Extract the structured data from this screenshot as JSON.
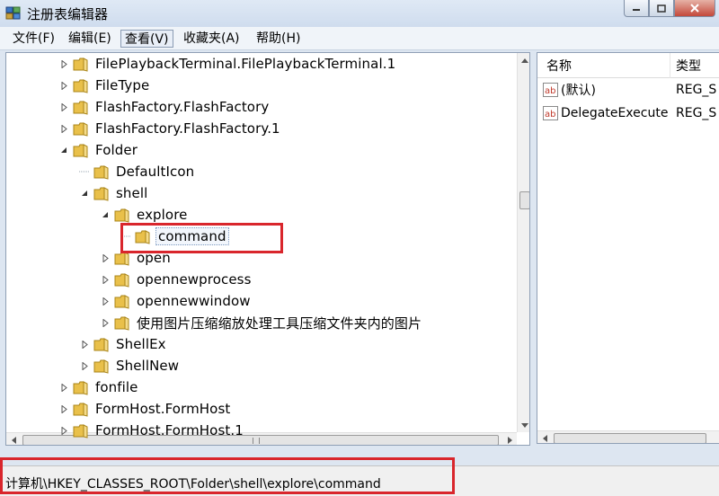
{
  "window": {
    "title": "注册表编辑器"
  },
  "menu": [
    {
      "label": "文件(F)",
      "active": false
    },
    {
      "label": "编辑(E)",
      "active": false
    },
    {
      "label": "查看(V)",
      "active": true
    },
    {
      "label": "收藏夹(A)",
      "active": false
    },
    {
      "label": "帮助(H)",
      "active": false
    }
  ],
  "tree": [
    {
      "label": "FilePlaybackTerminal.FilePlaybackTerminal.1",
      "level": 0,
      "state": "collapsed"
    },
    {
      "label": "FileType",
      "level": 0,
      "state": "collapsed"
    },
    {
      "label": "FlashFactory.FlashFactory",
      "level": 0,
      "state": "collapsed"
    },
    {
      "label": "FlashFactory.FlashFactory.1",
      "level": 0,
      "state": "collapsed"
    },
    {
      "label": "Folder",
      "level": 0,
      "state": "expanded"
    },
    {
      "label": "DefaultIcon",
      "level": 1,
      "state": "leaf"
    },
    {
      "label": "shell",
      "level": 1,
      "state": "expanded"
    },
    {
      "label": "explore",
      "level": 2,
      "state": "expanded"
    },
    {
      "label": "command",
      "level": 3,
      "state": "leaf",
      "selected": true
    },
    {
      "label": "open",
      "level": 2,
      "state": "collapsed"
    },
    {
      "label": "opennewprocess",
      "level": 2,
      "state": "collapsed"
    },
    {
      "label": "opennewwindow",
      "level": 2,
      "state": "collapsed"
    },
    {
      "label": "使用图片压缩缩放处理工具压缩文件夹内的图片",
      "level": 2,
      "state": "collapsed"
    },
    {
      "label": "ShellEx",
      "level": 1,
      "state": "collapsed"
    },
    {
      "label": "ShellNew",
      "level": 1,
      "state": "collapsed"
    },
    {
      "label": "fonfile",
      "level": 0,
      "state": "collapsed"
    },
    {
      "label": "FormHost.FormHost",
      "level": 0,
      "state": "collapsed"
    },
    {
      "label": "FormHost.FormHost.1",
      "level": 0,
      "state": "collapsed"
    }
  ],
  "values_pane": {
    "columns": {
      "name": "名称",
      "type": "类型"
    },
    "rows": [
      {
        "name": "(默认)",
        "type": "REG_S",
        "icon": "string-value-icon"
      },
      {
        "name": "DelegateExecute",
        "type": "REG_S",
        "icon": "string-value-icon"
      }
    ]
  },
  "status": {
    "path": "计算机\\HKEY_CLASSES_ROOT\\Folder\\shell\\explore\\command"
  },
  "colors": {
    "annotation": "#d9262c",
    "folder": "#e9c04a"
  }
}
